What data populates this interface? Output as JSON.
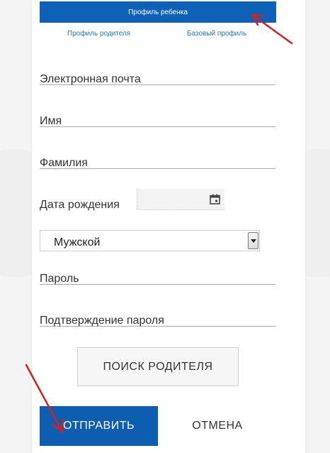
{
  "tabs": {
    "active": "Профиль ребенка",
    "parent": "Профиль родителя",
    "basic": "Базовый профиль"
  },
  "fields": {
    "email": "Электронная почта",
    "first_name": "Имя",
    "last_name": "Фамилия",
    "birth_date": "Дата рождения",
    "password": "Пароль",
    "password_confirm": "Подтверждение пароля"
  },
  "gender_select": {
    "value": "Мужской"
  },
  "buttons": {
    "search_parent": "ПОИСК РОДИТЕЛЯ",
    "submit": "ОТПРАВИТЬ",
    "cancel": "ОТМЕНА"
  },
  "colors": {
    "accent": "#0d62b8",
    "link": "#1b7bc6",
    "annotation_arrow": "#d42020"
  },
  "icons": [
    "calendar-icon",
    "dropdown-arrow-icon",
    "annotation-arrow"
  ]
}
